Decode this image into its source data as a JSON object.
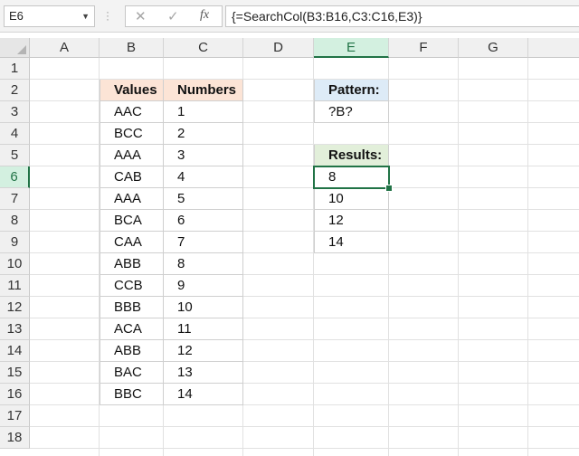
{
  "formula_bar": {
    "name_box": "E6",
    "cancel_icon": "✕",
    "enter_icon": "✓",
    "fx_label": "fx",
    "formula": "{=SearchCol(B3:B16,C3:C16,E3)}"
  },
  "columns": [
    "A",
    "B",
    "C",
    "D",
    "E",
    "F",
    "G"
  ],
  "rows": [
    "1",
    "2",
    "3",
    "4",
    "5",
    "6",
    "7",
    "8",
    "9",
    "10",
    "11",
    "12",
    "13",
    "14",
    "15",
    "16",
    "17",
    "18"
  ],
  "table": {
    "header_values": "Values",
    "header_numbers": "Numbers",
    "values": [
      "AAC",
      "BCC",
      "AAA",
      "CAB",
      "AAA",
      "BCA",
      "CAA",
      "ABB",
      "CCB",
      "BBB",
      "ACA",
      "ABB",
      "BAC",
      "BBC"
    ],
    "numbers": [
      "1",
      "2",
      "3",
      "4",
      "5",
      "6",
      "7",
      "8",
      "9",
      "10",
      "11",
      "12",
      "13",
      "14"
    ]
  },
  "pattern": {
    "label": "Pattern:",
    "value": "?B?"
  },
  "results": {
    "label": "Results:",
    "values": [
      "8",
      "10",
      "12",
      "14"
    ]
  },
  "colors": {
    "accent": "#217346",
    "values_header": "#fce4d6",
    "pattern_header": "#ddebf7",
    "results_header": "#e2efda"
  },
  "selection": {
    "cell": "E6",
    "column": "E",
    "row": "6"
  }
}
